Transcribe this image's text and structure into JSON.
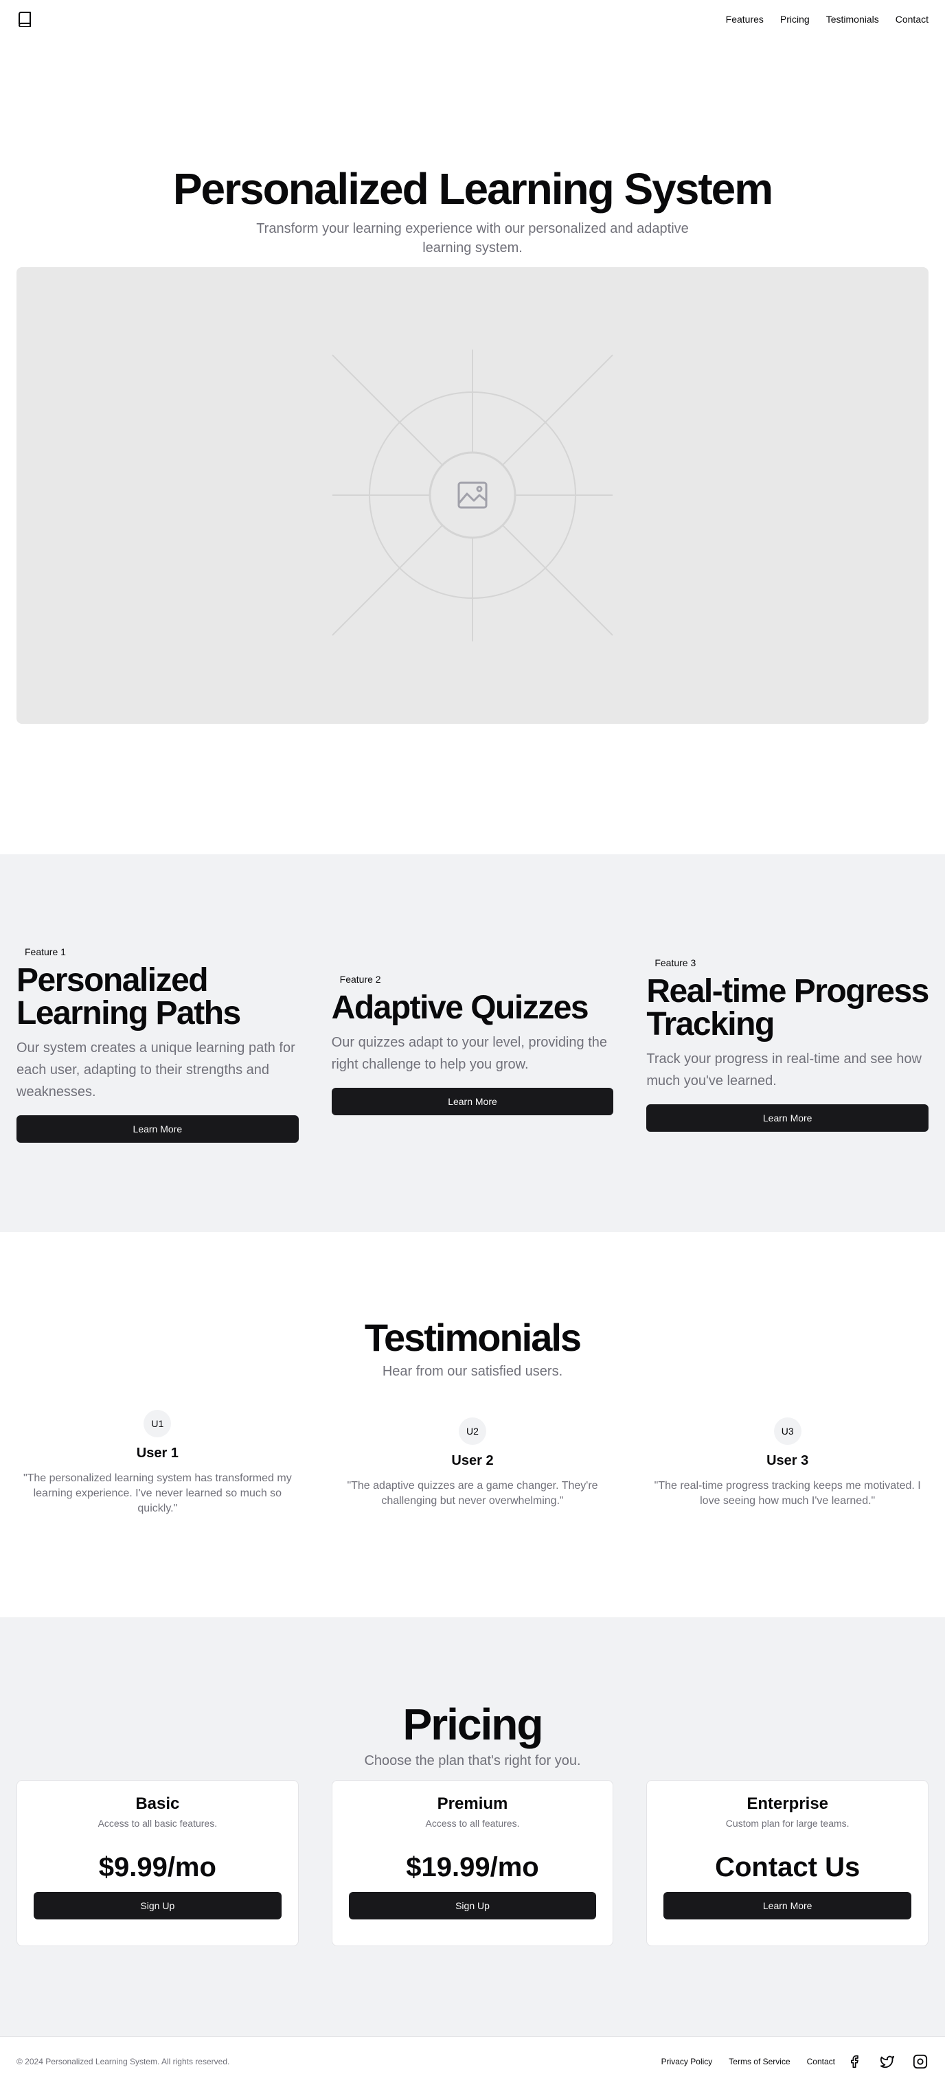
{
  "nav": {
    "logo_icon": "book-icon",
    "links": [
      "Features",
      "Pricing",
      "Testimonials",
      "Contact"
    ]
  },
  "hero": {
    "title": "Personalized Learning System",
    "subtitle": "Transform your learning experience with our personalized and adaptive learning system.",
    "image_icon": "image-placeholder-icon"
  },
  "features": [
    {
      "badge": "Feature 1",
      "title": "Personalized Learning Paths",
      "description": "Our system creates a unique learning path for each user, adapting to their strengths and weaknesses.",
      "button": "Learn More"
    },
    {
      "badge": "Feature 2",
      "title": "Adaptive Quizzes",
      "description": "Our quizzes adapt to your level, providing the right challenge to help you grow.",
      "button": "Learn More"
    },
    {
      "badge": "Feature 3",
      "title": "Real-time Progress Tracking",
      "description": "Track your progress in real-time and see how much you've learned.",
      "button": "Learn More"
    }
  ],
  "testimonials": {
    "title": "Testimonials",
    "subtitle": "Hear from our satisfied users.",
    "items": [
      {
        "initials": "U1",
        "name": "User 1",
        "quote": "\"The personalized learning system has transformed my learning experience. I've never learned so much so quickly.\""
      },
      {
        "initials": "U2",
        "name": "User 2",
        "quote": "\"The adaptive quizzes are a game changer. They're challenging but never overwhelming.\""
      },
      {
        "initials": "U3",
        "name": "User 3",
        "quote": "\"The real-time progress tracking keeps me motivated. I love seeing how much I've learned.\""
      }
    ]
  },
  "pricing": {
    "title": "Pricing",
    "subtitle": "Choose the plan that's right for you.",
    "plans": [
      {
        "name": "Basic",
        "description": "Access to all basic features.",
        "price": "$9.99/mo",
        "button": "Sign Up"
      },
      {
        "name": "Premium",
        "description": "Access to all features.",
        "price": "$19.99/mo",
        "button": "Sign Up"
      },
      {
        "name": "Enterprise",
        "description": "Custom plan for large teams.",
        "price": "Contact Us",
        "button": "Learn More"
      }
    ]
  },
  "footer": {
    "copyright": "© 2024 Personalized Learning System. All rights reserved.",
    "links": [
      "Privacy Policy",
      "Terms of Service",
      "Contact"
    ],
    "social_icons": [
      "facebook-icon",
      "twitter-icon",
      "instagram-icon"
    ]
  },
  "colors": {
    "primary_button": "#18181b",
    "muted_text": "#71717a",
    "section_bg": "#f1f2f4"
  }
}
